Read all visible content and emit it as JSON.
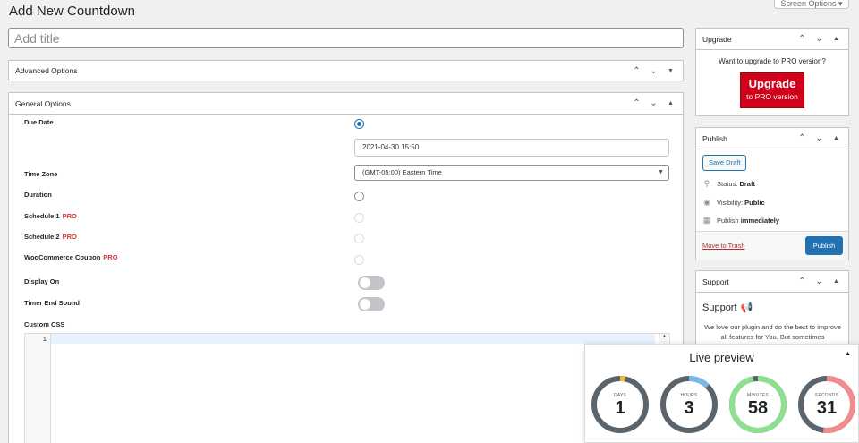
{
  "header": {
    "screen_options": "Screen Options ▾",
    "page_title": "Add New Countdown"
  },
  "title_field": {
    "placeholder": "Add title"
  },
  "advanced_options": {
    "title": "Advanced Options"
  },
  "general_options": {
    "title": "General Options",
    "due_date_label": "Due Date",
    "due_date_value": "2021-04-30 15:50",
    "time_zone_label": "Time Zone",
    "time_zone_value": "(GMT-05:00) Eastern Time",
    "duration_label": "Duration",
    "schedule1_label": "Schedule 1",
    "schedule2_label": "Schedule 2",
    "woo_label": "WooCommerce Coupon",
    "pro_badge": "PRO",
    "display_on_label": "Display On",
    "timer_end_sound_label": "Timer End Sound",
    "custom_css_label": "Custom CSS",
    "code_line_number": "1"
  },
  "upgrade_box": {
    "title": "Upgrade",
    "text": "Want to upgrade to PRO version?",
    "button_big": "Upgrade",
    "button_small": "to PRO version"
  },
  "publish_box": {
    "title": "Publish",
    "save_draft": "Save Draft",
    "status_label": "Status:",
    "status_value": "Draft",
    "visibility_label": "Visibility:",
    "visibility_value": "Public",
    "publish_label": "Publish",
    "publish_value": "immediately",
    "trash": "Move to Trash",
    "publish_button": "Publish"
  },
  "support_box": {
    "title": "Support",
    "heading": "Support",
    "text": "We love our plugin and do the best to improve all features for You. But sometimes"
  },
  "live_preview": {
    "title": "Live preview",
    "timers": [
      {
        "unit": "DAYS",
        "value": "1",
        "progress": 0.03,
        "color": "#f6b73c"
      },
      {
        "unit": "HOURS",
        "value": "3",
        "progress": 0.125,
        "color": "#7ab8e8"
      },
      {
        "unit": "MINUTES",
        "value": "58",
        "progress": 0.97,
        "color": "#8de08d"
      },
      {
        "unit": "SECONDS",
        "value": "31",
        "progress": 0.52,
        "color": "#f28b8b"
      }
    ],
    "track_color": "#5b636b"
  }
}
